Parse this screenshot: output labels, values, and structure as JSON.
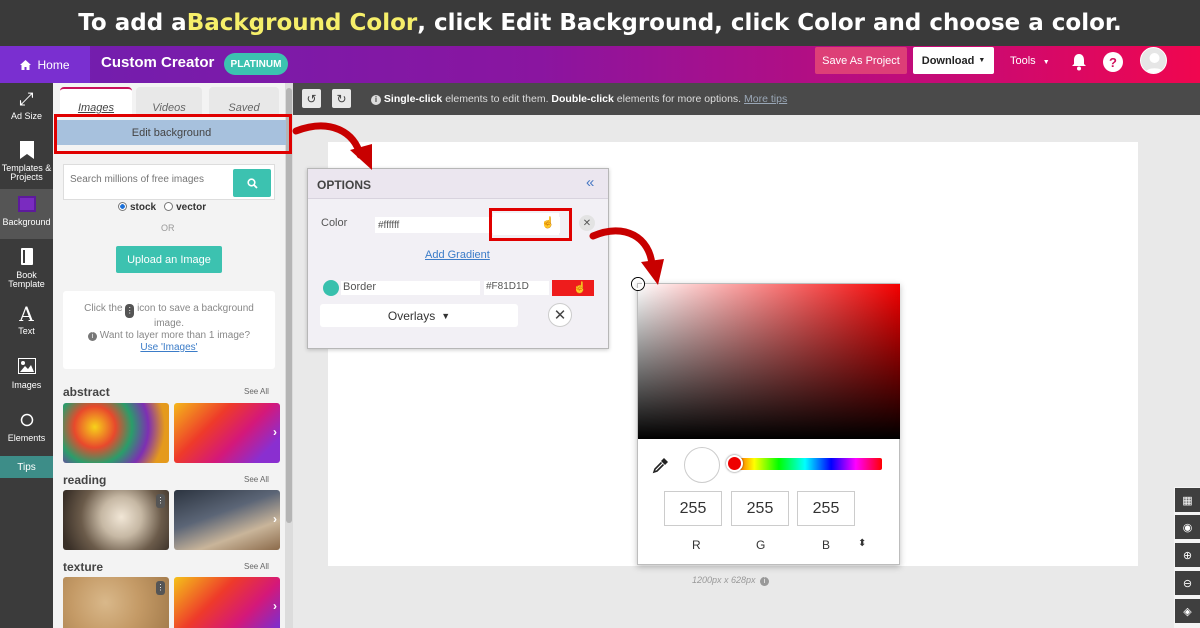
{
  "banner": {
    "prefix": "To add a ",
    "highlight": "Background Color",
    "suffix": ", click Edit Background, click Color and choose a color."
  },
  "header": {
    "home_label": "Home",
    "app_title": "Custom Creator",
    "plan_badge": "PLATINUM",
    "save_project_label": "Save As Project",
    "download_label": "Download",
    "tools_label": "Tools",
    "help_label": "?"
  },
  "leftnav": {
    "items": [
      {
        "label": "Ad Size",
        "icon": "resize-icon"
      },
      {
        "label": "Templates & Projects",
        "icon": "bookmark-icon"
      },
      {
        "label": "Background",
        "icon": "background-icon"
      },
      {
        "label": "Book Template",
        "icon": "book-icon"
      },
      {
        "label": "Text",
        "icon": "text-icon"
      },
      {
        "label": "Images",
        "icon": "image-icon"
      },
      {
        "label": "Elements",
        "icon": "circle-icon"
      }
    ],
    "tips_label": "Tips"
  },
  "panel": {
    "tabs": [
      "Images",
      "Videos",
      "Saved"
    ],
    "edit_background_label": "Edit background",
    "search_placeholder": "Search millions of free images",
    "radio_options": [
      "stock",
      "vector"
    ],
    "selected_radio": "stock",
    "or_label": "OR",
    "upload_label": "Upload an Image",
    "info_line1_pre": "Click the",
    "info_line1_post": "icon to save a background image.",
    "info_line2": "Want to layer more than 1 image?",
    "info_link": "Use 'Images'",
    "sections": [
      {
        "title": "abstract",
        "see_all": "See All"
      },
      {
        "title": "reading",
        "see_all": "See All"
      },
      {
        "title": "texture",
        "see_all": "See All"
      }
    ]
  },
  "toolbar": {
    "hint_bold1": "Single-click",
    "hint_text1": " elements to edit them. ",
    "hint_bold2": "Double-click",
    "hint_text2": " elements for more options. ",
    "hint_link": "More tips"
  },
  "canvas": {
    "dimensions": "1200px x 628px"
  },
  "options": {
    "title": "OPTIONS",
    "color_label": "Color",
    "color_value": "#ffffff",
    "add_gradient": "Add Gradient",
    "border_label": "Border",
    "border_value": "#F81D1D",
    "overlays_label": "Overlays"
  },
  "picker": {
    "r": "255",
    "g": "255",
    "b": "255",
    "labels": [
      "R",
      "G",
      "B"
    ]
  },
  "colors": {
    "accent_teal": "#3cc2b0",
    "border_color": "#F81D1D",
    "annotation_red": "#e00000"
  }
}
